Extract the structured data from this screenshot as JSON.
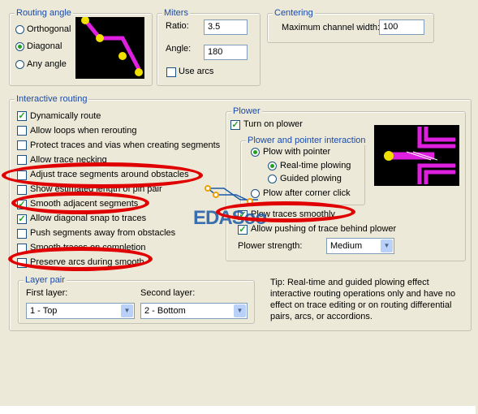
{
  "routing_angle": {
    "title": "Routing angle",
    "options": [
      {
        "label": "Orthogonal",
        "selected": false
      },
      {
        "label": "Diagonal",
        "selected": true
      },
      {
        "label": "Any angle",
        "selected": false
      }
    ]
  },
  "miters": {
    "title": "Miters",
    "ratio_label": "Ratio:",
    "ratio_value": "3.5",
    "angle_label": "Angle:",
    "angle_value": "180",
    "use_arcs_label": "Use arcs",
    "use_arcs_checked": false
  },
  "centering": {
    "title": "Centering",
    "max_channel_label": "Maximum channel width:",
    "max_channel_value": "100"
  },
  "interactive_routing": {
    "title": "Interactive routing",
    "options": [
      {
        "label": "Dynamically route",
        "checked": true
      },
      {
        "label": "Allow loops when rerouting",
        "checked": false
      },
      {
        "label": "Protect traces and vias when creating segments",
        "checked": false
      },
      {
        "label": "Allow trace necking",
        "checked": false
      },
      {
        "label": "Adjust trace segments around obstacles",
        "checked": false
      },
      {
        "label": "Show estimated length of pin pair",
        "checked": false
      },
      {
        "label": "Smooth adjacent segments",
        "checked": true
      },
      {
        "label": "Allow diagonal snap to traces",
        "checked": true
      },
      {
        "label": "Push segments away from obstacles",
        "checked": false
      },
      {
        "label": "Smooth traces on completion",
        "checked": false
      },
      {
        "label": "Preserve arcs during smooth",
        "checked": false
      }
    ]
  },
  "plower": {
    "title": "Plower",
    "turn_on_label": "Turn on plower",
    "turn_on_checked": true,
    "interaction_title": "Plower and pointer interaction",
    "plow_with_pointer": "Plow with pointer",
    "realtime": "Real-time plowing",
    "guided": "Guided plowing",
    "plow_after_corner": "Plow after corner click",
    "plow_smoothly": "Plow traces smoothly",
    "allow_pushing": "Allow pushing of trace behind plower",
    "strength_label": "Plower strength:",
    "strength_value": "Medium"
  },
  "layer_pair": {
    "title": "Layer pair",
    "first_label": "First layer:",
    "first_value": "1 - Top",
    "second_label": "Second layer:",
    "second_value": "2 - Bottom"
  },
  "tip": "Tip: Real-time and guided plowing effect interactive routing operations only and have no effect on trace editing or on routing differential pairs, arcs, or accordions.",
  "watermark": "EDASoo",
  "colors": {
    "trace": "#e020e0",
    "pad": "#f0e000",
    "annotation": "#e00000",
    "group_label": "#1b4aa8"
  }
}
